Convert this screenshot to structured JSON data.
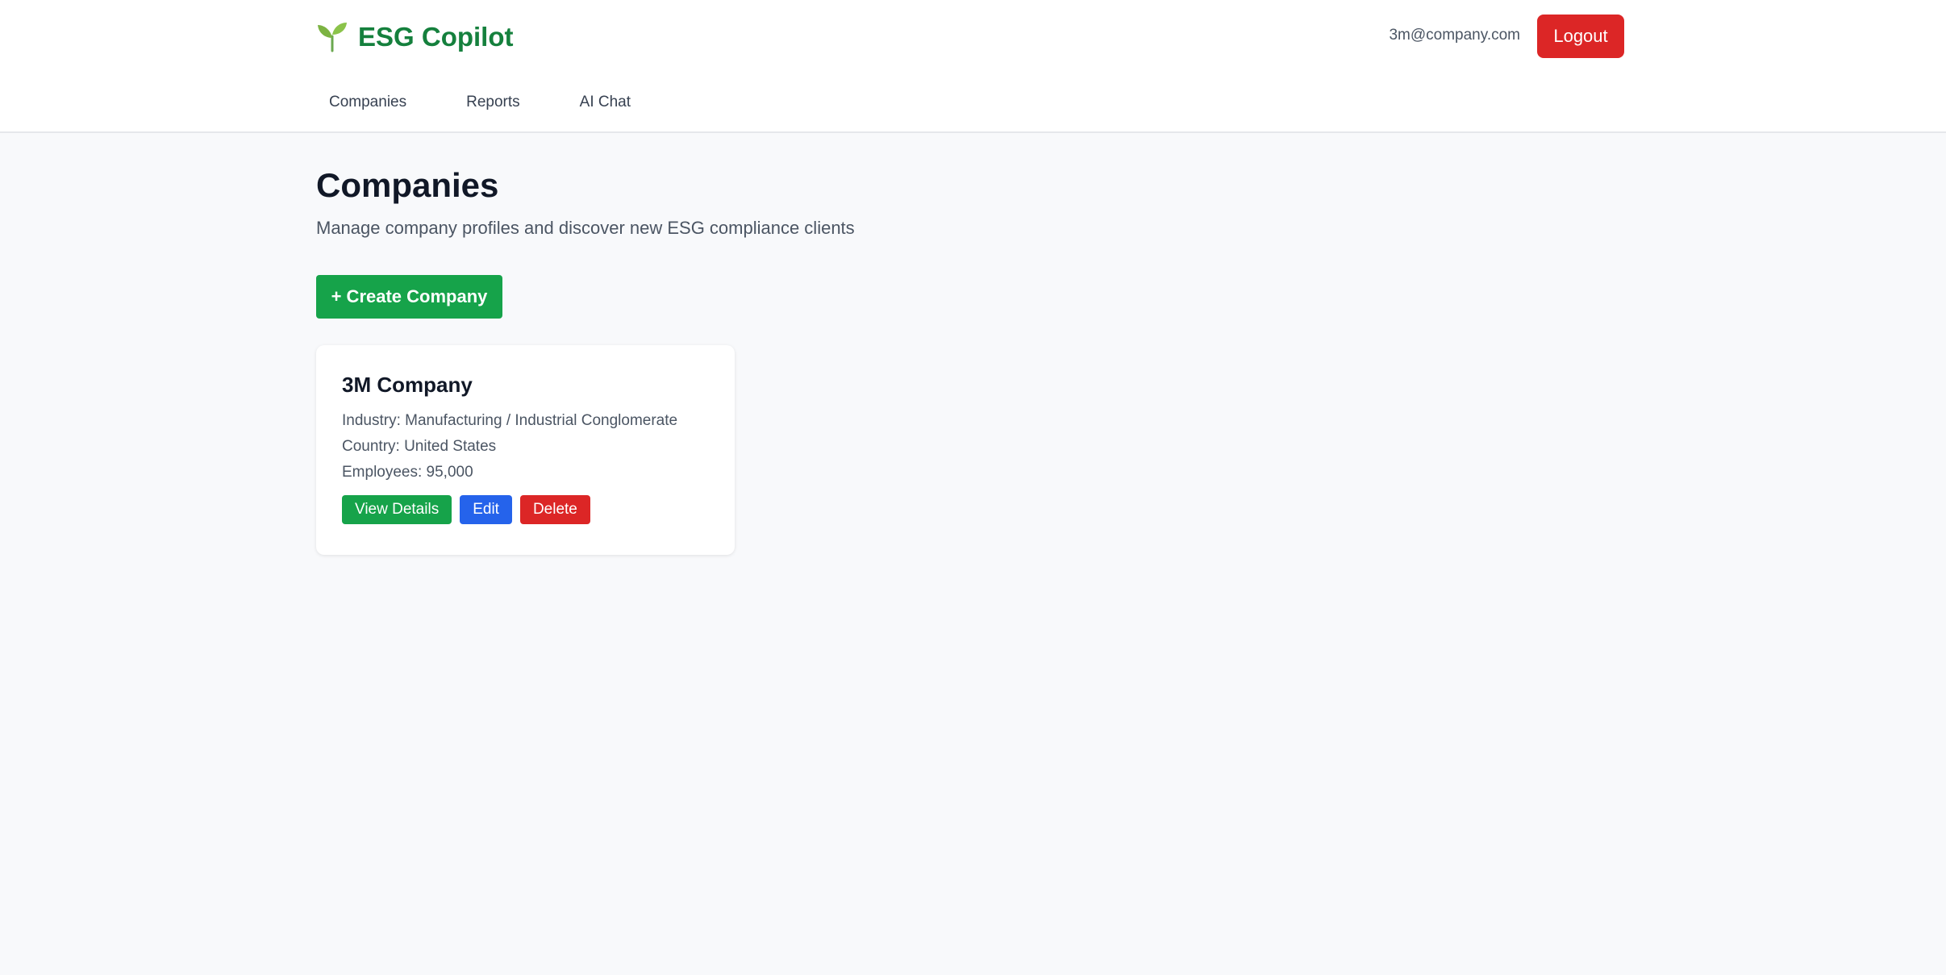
{
  "app": {
    "name": "ESG Copilot",
    "brand_icon": "seedling-icon",
    "brand_color": "#15803d"
  },
  "header": {
    "user_email": "3m@company.com",
    "logout_label": "Logout",
    "logout_color": "#dc2626"
  },
  "nav": {
    "items": [
      {
        "label": "Companies"
      },
      {
        "label": "Reports"
      },
      {
        "label": "AI Chat"
      }
    ]
  },
  "page": {
    "title": "Companies",
    "subtitle": "Manage company profiles and discover new ESG compliance clients",
    "create_label": "+ Create Company",
    "primary_color": "#16a34a"
  },
  "companies": [
    {
      "name": "3M Company",
      "industry_text": "Industry: Manufacturing / Industrial Conglomerate",
      "country_text": "Country: United States",
      "employees_text": "Employees: 95,000",
      "actions": {
        "view": "View Details",
        "edit": "Edit",
        "delete": "Delete"
      }
    }
  ]
}
